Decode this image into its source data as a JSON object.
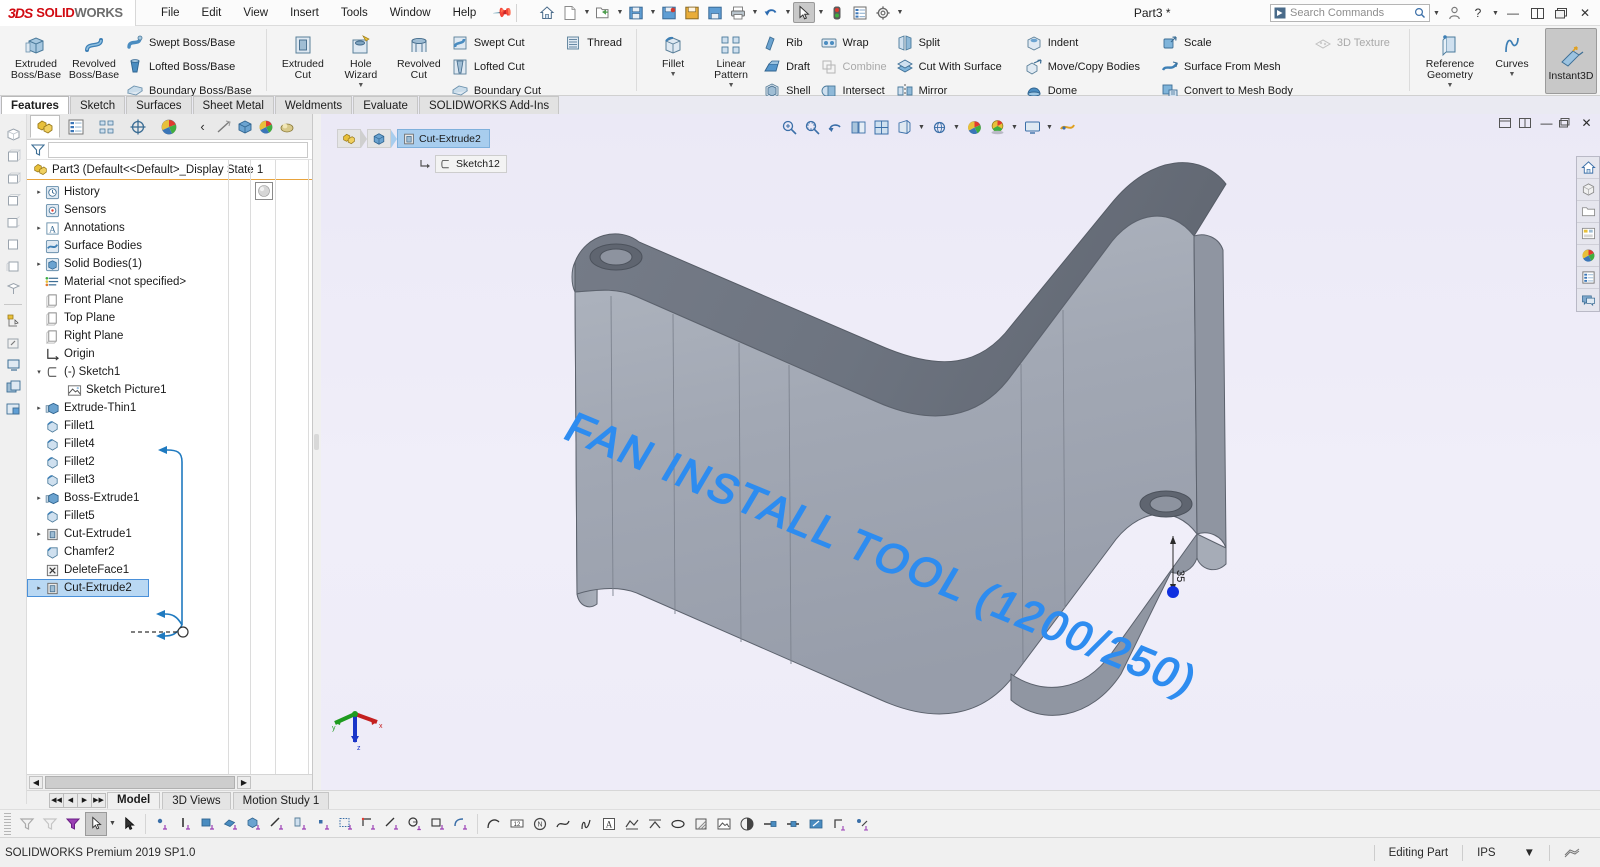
{
  "app": {
    "brand_ds": "3DS",
    "brand_solid": "SOLID",
    "brand_works": "WORKS",
    "document_title": "Part3 *",
    "status_product": "SOLIDWORKS Premium 2019 SP1.0",
    "status_editing": "Editing Part",
    "status_units": "IPS",
    "accent_blue": "#2d8cf0",
    "selection_blue": "#b9d8f3",
    "viewport_bg": "#eceaf7",
    "model_gray": "#9aa0ab",
    "model_top_gray": "#6e7480"
  },
  "menu": {
    "items": [
      "File",
      "Edit",
      "View",
      "Insert",
      "Tools",
      "Window",
      "Help"
    ],
    "pin_icon": "pin-icon"
  },
  "quick_access": {
    "buttons": [
      {
        "name": "home-icon",
        "glyph": "home"
      },
      {
        "name": "new-document-icon",
        "glyph": "doc"
      },
      {
        "name": "open-document-icon",
        "glyph": "open"
      },
      {
        "name": "save-icon",
        "glyph": "save"
      },
      {
        "name": "save-as-icon",
        "glyph": "saveas"
      },
      {
        "name": "save-all-icon",
        "glyph": "saveall"
      },
      {
        "name": "save-detail-icon",
        "glyph": "savedetail"
      },
      {
        "name": "print-icon",
        "glyph": "print"
      },
      {
        "name": "undo-icon",
        "glyph": "undo"
      },
      {
        "name": "select-cursor-icon",
        "glyph": "cursor"
      },
      {
        "name": "rebuild-icon",
        "glyph": "traffic"
      },
      {
        "name": "file-properties-icon",
        "glyph": "props"
      },
      {
        "name": "options-gear-icon",
        "glyph": "gear"
      }
    ]
  },
  "search": {
    "placeholder": "Search Commands",
    "icon": "search-icon"
  },
  "window_controls": {
    "profile": "user-icon",
    "help": "?",
    "minimize": "—",
    "restore_down": "restore-icon",
    "maximize": "maximize-icon",
    "close": "✕"
  },
  "ribbon": {
    "groups": [
      {
        "name": "boss-base-group",
        "big": [
          {
            "label": "Extruded\nBoss/Base",
            "icon": "extruded-boss-icon"
          },
          {
            "label": "Revolved\nBoss/Base",
            "icon": "revolved-boss-icon"
          }
        ],
        "small": [
          {
            "label": "Swept Boss/Base",
            "icon": "swept-boss-icon",
            "dim": false
          },
          {
            "label": "Lofted Boss/Base",
            "icon": "lofted-boss-icon",
            "dim": false
          },
          {
            "label": "Boundary Boss/Base",
            "icon": "boundary-boss-icon",
            "dim": false
          }
        ]
      },
      {
        "name": "cut-group",
        "big": [
          {
            "label": "Extruded\nCut",
            "icon": "extruded-cut-icon"
          },
          {
            "label": "Hole\nWizard",
            "icon": "hole-wizard-icon",
            "dropdown": true
          },
          {
            "label": "Revolved\nCut",
            "icon": "revolved-cut-icon"
          }
        ],
        "small": [
          {
            "label": "Swept Cut",
            "icon": "swept-cut-icon",
            "dim": false
          },
          {
            "label": "Lofted Cut",
            "icon": "lofted-cut-icon",
            "dim": false
          },
          {
            "label": "Boundary Cut",
            "icon": "boundary-cut-icon",
            "dim": false
          }
        ],
        "small2": [
          {
            "label": "Thread",
            "icon": "thread-icon",
            "dim": false
          }
        ]
      },
      {
        "name": "features-group",
        "big": [
          {
            "label": "Fillet",
            "icon": "fillet-icon",
            "dropdown": true
          },
          {
            "label": "Linear\nPattern",
            "icon": "linear-pattern-icon",
            "dropdown": true
          }
        ],
        "small": [
          {
            "label": "Rib",
            "icon": "rib-icon",
            "dim": false
          },
          {
            "label": "Draft",
            "icon": "draft-icon",
            "dim": false
          },
          {
            "label": "Shell",
            "icon": "shell-icon",
            "dim": false
          }
        ],
        "small2": [
          {
            "label": "Wrap",
            "icon": "wrap-icon",
            "dim": false
          },
          {
            "label": "Combine",
            "icon": "combine-icon",
            "dim": true
          },
          {
            "label": "Intersect",
            "icon": "intersect-icon",
            "dim": false
          }
        ],
        "small3": [
          {
            "label": "Split",
            "icon": "split-icon",
            "dim": false
          },
          {
            "label": "Cut With Surface",
            "icon": "cut-with-surface-icon",
            "dim": false
          },
          {
            "label": "Mirror",
            "icon": "mirror-icon",
            "dim": false
          }
        ],
        "small4": [
          {
            "label": "Indent",
            "icon": "indent-icon",
            "dim": false
          },
          {
            "label": "Move/Copy Bodies",
            "icon": "move-copy-bodies-icon",
            "dim": false
          },
          {
            "label": "Dome",
            "icon": "dome-icon",
            "dim": false
          }
        ],
        "small5": [
          {
            "label": "Scale",
            "icon": "scale-icon",
            "dim": false
          },
          {
            "label": "Surface From Mesh",
            "icon": "surface-from-mesh-icon",
            "dim": false
          },
          {
            "label": "Convert to Mesh Body",
            "icon": "convert-to-mesh-body-icon",
            "dim": false
          }
        ],
        "small6": [
          {
            "label": "3D Texture",
            "icon": "3d-texture-icon",
            "dim": true
          }
        ]
      },
      {
        "name": "reference-group",
        "big": [
          {
            "label": "Reference\nGeometry",
            "icon": "reference-geometry-icon",
            "dropdown": true
          },
          {
            "label": "Curves",
            "icon": "curves-icon",
            "dropdown": true
          }
        ]
      },
      {
        "name": "instant3d-group",
        "big": [
          {
            "label": "Instant3D",
            "icon": "instant3d-icon",
            "active": true
          }
        ]
      }
    ]
  },
  "command_tabs": {
    "items": [
      "Features",
      "Sketch",
      "Surfaces",
      "Sheet Metal",
      "Weldments",
      "Evaluate",
      "SOLIDWORKS Add-Ins"
    ],
    "active_index": 0
  },
  "feature_manager": {
    "tabs": [
      {
        "name": "feature-manager-tab",
        "icon": "feature-tree-icon",
        "selected": true
      },
      {
        "name": "property-manager-tab",
        "icon": "property-manager-icon",
        "selected": false
      },
      {
        "name": "configuration-manager-tab",
        "icon": "configuration-manager-icon",
        "selected": false
      },
      {
        "name": "dimxpert-manager-tab",
        "icon": "dimxpert-icon",
        "selected": false
      },
      {
        "name": "display-manager-tab",
        "icon": "display-manager-icon",
        "selected": false
      }
    ],
    "tools": [
      {
        "name": "collapse-icon",
        "glyph": "‹"
      },
      {
        "name": "hide-show-icon",
        "glyph": "hide"
      },
      {
        "name": "view-orientation-icon",
        "glyph": "cube"
      },
      {
        "name": "appearance-icon",
        "glyph": "palette"
      },
      {
        "name": "scene-icon",
        "glyph": "scene"
      }
    ],
    "filter_placeholder": "",
    "filter_icon": "filter-icon",
    "root": {
      "label": "Part3  (Default<<Default>_Display State 1",
      "icon": "part-icon"
    },
    "tree": [
      {
        "label": "History",
        "icon": "history-icon",
        "expandable": true,
        "indent": 0
      },
      {
        "label": "Sensors",
        "icon": "sensors-icon",
        "expandable": false,
        "indent": 0
      },
      {
        "label": "Annotations",
        "icon": "annotations-icon",
        "expandable": true,
        "indent": 0
      },
      {
        "label": "Surface Bodies",
        "icon": "surface-bodies-icon",
        "expandable": false,
        "indent": 0
      },
      {
        "label": "Solid Bodies(1)",
        "icon": "solid-bodies-icon",
        "expandable": true,
        "indent": 0
      },
      {
        "label": "Material <not specified>",
        "icon": "material-icon",
        "expandable": false,
        "indent": 0
      },
      {
        "label": "Front Plane",
        "icon": "plane-icon",
        "expandable": false,
        "indent": 0
      },
      {
        "label": "Top Plane",
        "icon": "plane-icon",
        "expandable": false,
        "indent": 0
      },
      {
        "label": "Right Plane",
        "icon": "plane-icon",
        "expandable": false,
        "indent": 0
      },
      {
        "label": "Origin",
        "icon": "origin-icon",
        "expandable": false,
        "indent": 0
      },
      {
        "label": "(-) Sketch1",
        "icon": "sketch-icon",
        "expandable": true,
        "expanded": true,
        "indent": 0
      },
      {
        "label": "Sketch Picture1",
        "icon": "sketch-picture-icon",
        "expandable": false,
        "indent": 1
      },
      {
        "label": "Extrude-Thin1",
        "icon": "extrude-icon",
        "expandable": true,
        "indent": 0,
        "arrow": true
      },
      {
        "label": "Fillet1",
        "icon": "fillet-feature-icon",
        "expandable": false,
        "indent": 0
      },
      {
        "label": "Fillet4",
        "icon": "fillet-feature-icon",
        "expandable": false,
        "indent": 0
      },
      {
        "label": "Fillet2",
        "icon": "fillet-feature-icon",
        "expandable": false,
        "indent": 0
      },
      {
        "label": "Fillet3",
        "icon": "fillet-feature-icon",
        "expandable": false,
        "indent": 0
      },
      {
        "label": "Boss-Extrude1",
        "icon": "extrude-icon",
        "expandable": true,
        "indent": 0,
        "arrow": true
      },
      {
        "label": "Fillet5",
        "icon": "fillet-feature-icon",
        "expandable": false,
        "indent": 0,
        "arrow": true
      },
      {
        "label": "Cut-Extrude1",
        "icon": "cut-extrude-icon",
        "expandable": true,
        "indent": 0
      },
      {
        "label": "Chamfer2",
        "icon": "chamfer-icon",
        "expandable": false,
        "indent": 0
      },
      {
        "label": "DeleteFace1",
        "icon": "delete-face-icon",
        "expandable": false,
        "indent": 0
      },
      {
        "label": "Cut-Extrude2",
        "icon": "cut-extrude-icon",
        "expandable": true,
        "indent": 0,
        "selected": true
      }
    ]
  },
  "graphics": {
    "breadcrumb": [
      {
        "label": "",
        "icon": "part-icon"
      },
      {
        "label": "",
        "icon": "solid-body-icon"
      },
      {
        "label": "Cut-Extrude2",
        "icon": "cut-extrude-icon",
        "current": true
      }
    ],
    "sub_breadcrumb": {
      "label": "Sketch12",
      "icon": "sketch-icon",
      "parent_icon": "child-arrow-icon"
    },
    "view_toolbar": [
      {
        "name": "zoom-to-fit-icon"
      },
      {
        "name": "zoom-to-area-icon"
      },
      {
        "name": "previous-view-icon"
      },
      {
        "name": "section-view-icon"
      },
      {
        "name": "view-orientation-icon"
      },
      {
        "name": "display-style-icon"
      },
      {
        "name": "hide-show-items-icon"
      },
      {
        "name": "edit-appearance-icon"
      },
      {
        "name": "apply-scene-icon"
      },
      {
        "name": "view-settings-icon"
      },
      {
        "name": "rotate-view-icon"
      }
    ],
    "right_palette": [
      {
        "name": "view-palette-home-icon"
      },
      {
        "name": "appearances-box-icon"
      },
      {
        "name": "folder-icon"
      },
      {
        "name": "design-library-icon"
      },
      {
        "name": "appearances-scenes-icon"
      },
      {
        "name": "custom-properties-icon"
      },
      {
        "name": "comments-icon"
      }
    ],
    "window_buttons": [
      {
        "name": "restore-window-icon",
        "glyph": "❐"
      },
      {
        "name": "minimize-window-icon",
        "glyph": "–"
      },
      {
        "name": "maximize-window-icon",
        "glyph": "▫"
      },
      {
        "name": "close-window-icon",
        "glyph": "✕"
      }
    ],
    "model": {
      "engraved_text": "FAN INSTALL TOOL  (1200/250)",
      "engraved_color": "#2d8cf0",
      "dimension_label": "35"
    },
    "triad": {
      "x_label": "x",
      "y_label": "y",
      "z_label": "z"
    }
  },
  "bottom_tabs": {
    "items": [
      "Model",
      "3D Views",
      "Motion Study 1"
    ],
    "active_index": 0,
    "nav": [
      "◀◀",
      "◀",
      "▶",
      "▶▶"
    ]
  },
  "sketch_toolbar": {
    "buttons": [
      {
        "name": "filter-faces-icon"
      },
      {
        "name": "filter-edges-icon"
      },
      {
        "name": "filter-toggle-icon"
      },
      {
        "name": "select-tool-icon",
        "selected": true
      },
      {
        "name": "select-dropdown-caret"
      },
      {
        "name": "magnified-select-icon"
      },
      {
        "name": "point-icon"
      },
      {
        "name": "line-icon"
      },
      {
        "name": "rectangle-icon"
      },
      {
        "name": "polygon-icon"
      },
      {
        "name": "cube-sketch-icon"
      },
      {
        "name": "slot-line-icon"
      },
      {
        "name": "plane-sketch-icon"
      },
      {
        "name": "point-snap-icon"
      },
      {
        "name": "corner-rectangle-icon"
      },
      {
        "name": "parallelogram-icon"
      },
      {
        "name": "centerline-icon"
      },
      {
        "name": "circle-icon"
      },
      {
        "name": "straight-slot-icon"
      },
      {
        "name": "fillet-sketch-icon"
      },
      {
        "name": "arc-icon"
      },
      {
        "name": "dimension-icon"
      },
      {
        "name": "smart-dimension-icon"
      },
      {
        "name": "spline-icon"
      },
      {
        "name": "equation-driven-curve-icon"
      },
      {
        "name": "text-icon"
      },
      {
        "name": "construction-geometry-icon"
      },
      {
        "name": "mirror-entities-icon"
      },
      {
        "name": "ellipse-icon"
      },
      {
        "name": "shaded-sketch-icon"
      },
      {
        "name": "sketch-picture-icon"
      },
      {
        "name": "partial-ellipse-icon"
      },
      {
        "name": "trim-entities-icon"
      },
      {
        "name": "extend-entities-icon"
      },
      {
        "name": "offset-entities-icon"
      },
      {
        "name": "convert-entities-icon"
      },
      {
        "name": "repair-sketch-icon"
      }
    ]
  }
}
